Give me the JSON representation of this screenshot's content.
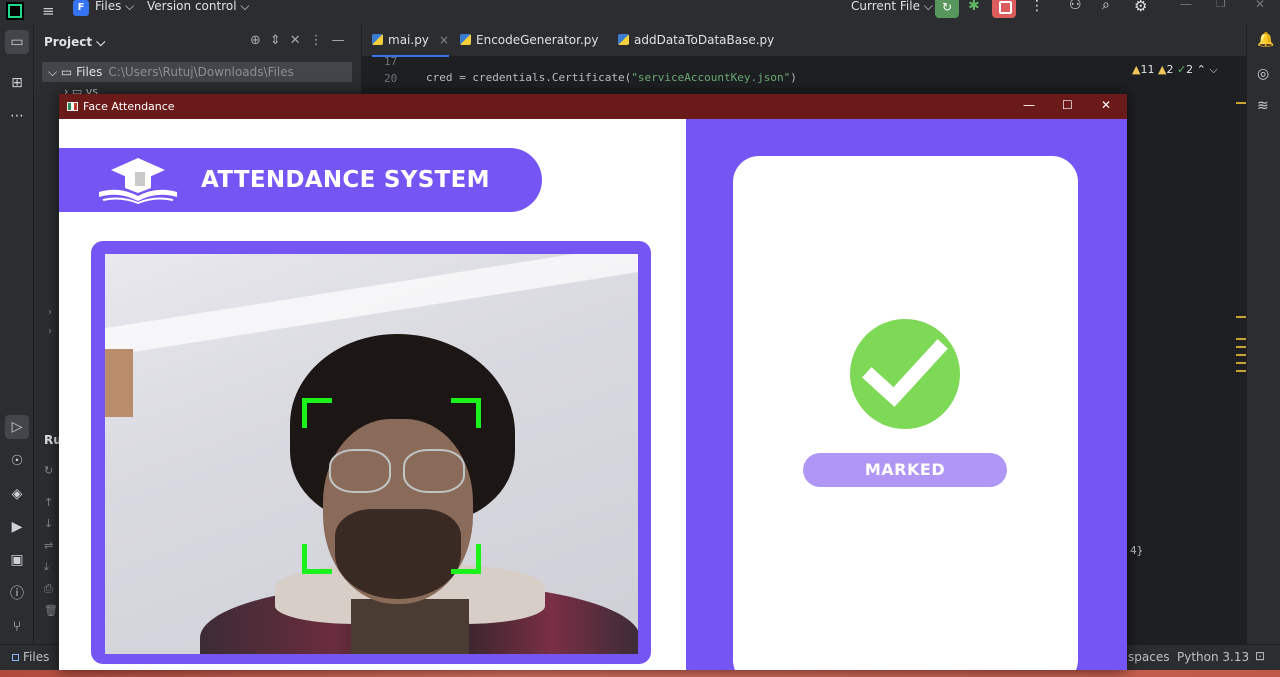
{
  "ide": {
    "project_badge": "F",
    "project_name": "Files ⌵",
    "version_control": "Version control ⌵",
    "run_config": "Current File ⌵",
    "project_panel_title": "Project ⌵",
    "tree_root_name": "Files",
    "tree_root_path": "C:\\Users\\Rutuj\\Downloads\\Files",
    "tree_child": "vs",
    "run_panel_label": "Ru",
    "tabs": [
      {
        "label": "mai.py",
        "active": true
      },
      {
        "label": "EncodeGenerator.py",
        "active": false
      },
      {
        "label": "addDataToDataBase.py",
        "active": false
      }
    ],
    "line_numbers": [
      "17",
      "20"
    ],
    "code_line_20_prefix": "cred = credentials.Certificate(",
    "code_line_20_string": "\"serviceAccountKey.json\"",
    "code_line_20_suffix": ")",
    "inspections": {
      "warnings": "11",
      "weak_warnings": "2",
      "ok": "2"
    },
    "ghost_text": "4}",
    "status": {
      "files": "Files",
      "indent": "spaces",
      "interpreter": "Python 3.13"
    }
  },
  "face_app": {
    "window_title": "Face Attendance",
    "banner_title": "ATTENDANCE SYSTEM",
    "status_label": "MARKED",
    "accent_color": "#7655f5",
    "check_color": "#7ed957",
    "face_box_color": "#1bf21b"
  }
}
